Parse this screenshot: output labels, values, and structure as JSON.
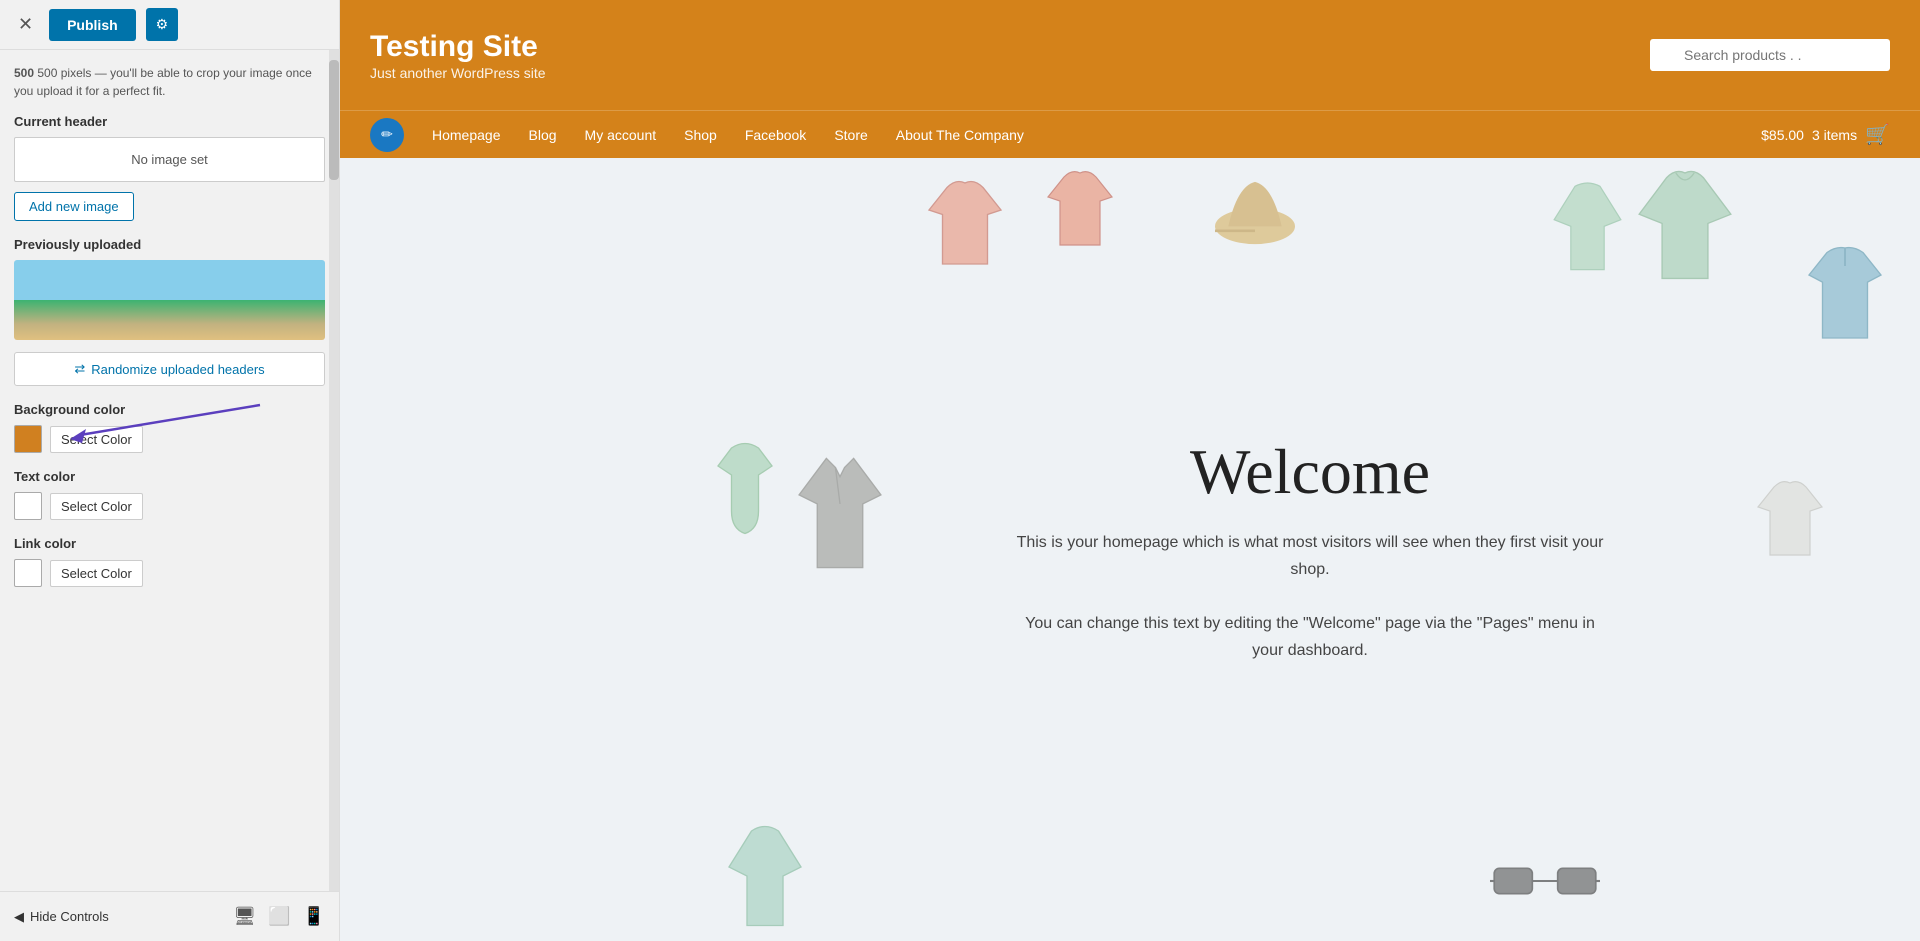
{
  "topbar": {
    "close_label": "✕",
    "publish_label": "Publish",
    "settings_icon": "⚙"
  },
  "panel": {
    "hint": "500 pixels — you'll be able to crop your image once you upload it for a perfect fit.",
    "hint_bold": "500",
    "current_header_label": "Current header",
    "no_image_label": "No image set",
    "add_image_label": "Add new image",
    "previously_label": "Previously uploaded",
    "randomize_label": "Randomize uploaded headers",
    "background_color_label": "Background color",
    "text_color_label": "Text color",
    "link_color_label": "Link color",
    "select_color_label": "Select Color"
  },
  "bottombar": {
    "hide_controls_label": "Hide Controls",
    "device_desktop": "🖥",
    "device_tablet": "⬜",
    "device_mobile": "📱"
  },
  "site": {
    "title": "Testing Site",
    "tagline": "Just another WordPress site",
    "search_placeholder": "Search products . .",
    "nav_items": [
      {
        "label": "Homepage"
      },
      {
        "label": "Blog"
      },
      {
        "label": "My account"
      },
      {
        "label": "Shop"
      },
      {
        "label": "Facebook"
      },
      {
        "label": "Store"
      },
      {
        "label": "About The Company"
      }
    ],
    "cart_price": "$85.00",
    "cart_items": "3 items",
    "welcome_title": "Welcome",
    "welcome_text_1": "This is your homepage which is what most visitors will see when they first visit your shop.",
    "welcome_text_2": "You can change this text by editing the \"Welcome\" page via the \"Pages\" menu in your dashboard."
  }
}
